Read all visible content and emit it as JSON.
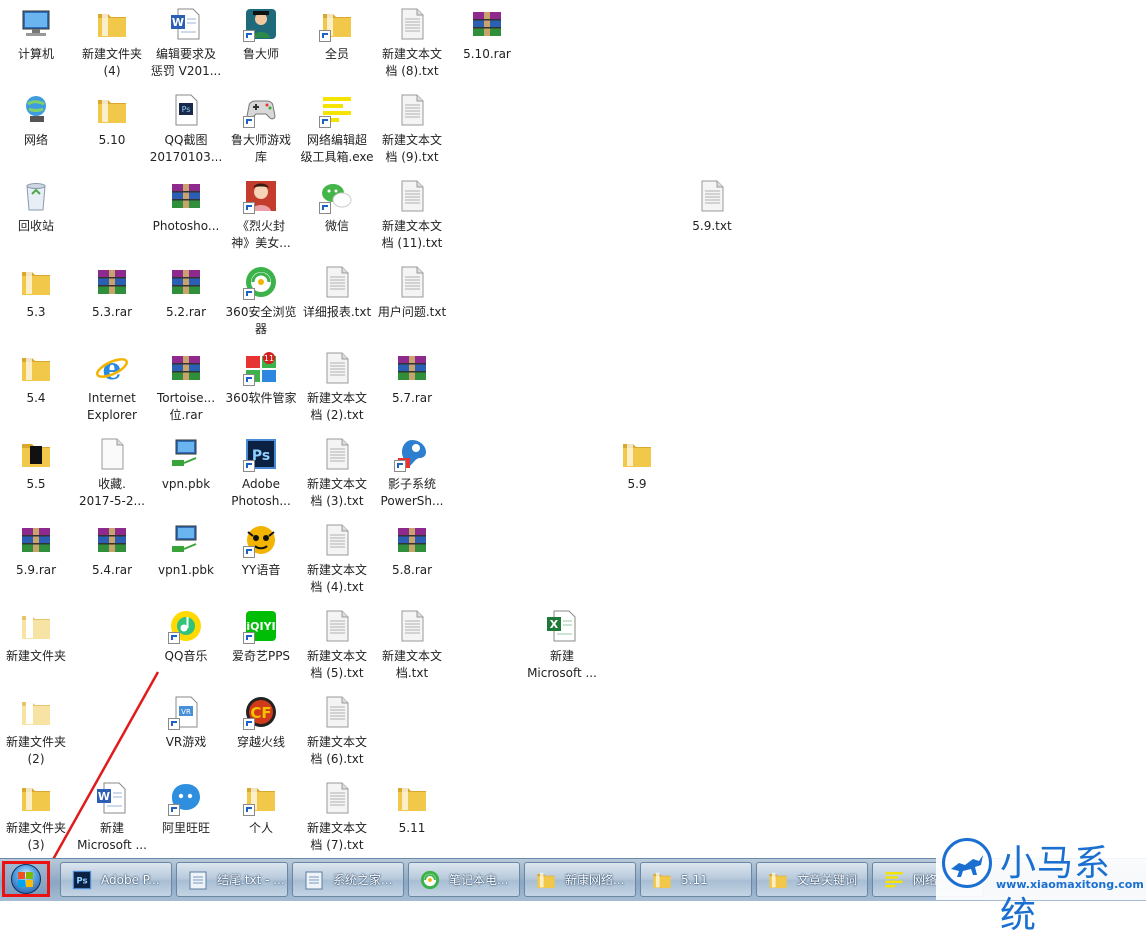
{
  "desktop_icons": [
    {
      "label": "计算机",
      "type": "computer"
    },
    {
      "label": "网络",
      "type": "network"
    },
    {
      "label": "回收站",
      "type": "recycle"
    },
    {
      "label": "5.3",
      "type": "folder"
    },
    {
      "label": "5.4",
      "type": "folder"
    },
    {
      "label": "5.5",
      "type": "folder-dark"
    },
    {
      "label": "5.9.rar",
      "type": "rar"
    },
    {
      "label": "新建文件夹",
      "type": "folder-light"
    },
    {
      "label": "新建文件夹\n(2)",
      "type": "folder-light"
    },
    {
      "label": "新建文件夹\n(3)",
      "type": "folder"
    },
    {
      "label": "新建文件夹\n(4)",
      "type": "folder"
    },
    {
      "label": "5.10",
      "type": "folder"
    },
    {
      "label": "5.3.rar",
      "type": "rar"
    },
    {
      "label": "Internet\nExplorer",
      "type": "ie"
    },
    {
      "label": "收藏.\n2017-5-2...",
      "type": "file"
    },
    {
      "label": "5.4.rar",
      "type": "rar"
    },
    {
      "label": "新建\nMicrosoft ...",
      "type": "word"
    },
    {
      "label": "编辑要求及\n惩罚 V201...",
      "type": "word"
    },
    {
      "label": "QQ截图\n20170103...",
      "type": "ps-file"
    },
    {
      "label": "Photosho...",
      "type": "rar"
    },
    {
      "label": "5.2.rar",
      "type": "rar"
    },
    {
      "label": "Tortoise...\n位.rar",
      "type": "rar"
    },
    {
      "label": "vpn.pbk",
      "type": "vpn"
    },
    {
      "label": "vpn1.pbk",
      "type": "vpn"
    },
    {
      "label": "QQ音乐",
      "type": "qqmusic"
    },
    {
      "label": "VR游戏",
      "type": "vr"
    },
    {
      "label": "阿里旺旺",
      "type": "wangwang"
    },
    {
      "label": "鲁大师",
      "type": "ludashi"
    },
    {
      "label": "鲁大师游戏\n库",
      "type": "gamepad"
    },
    {
      "label": "《烈火封\n神》美女...",
      "type": "game-girl"
    },
    {
      "label": "360安全浏览\n器",
      "type": "360browser"
    },
    {
      "label": "360软件管家",
      "type": "360mgr"
    },
    {
      "label": "Adobe\nPhotosh...",
      "type": "ps"
    },
    {
      "label": "YY语音",
      "type": "yy"
    },
    {
      "label": "爱奇艺PPS",
      "type": "iqiyi"
    },
    {
      "label": "穿越火线",
      "type": "cf"
    },
    {
      "label": "个人",
      "type": "folder"
    },
    {
      "label": "全员",
      "type": "folder"
    },
    {
      "label": "网络编辑超\n级工具箱.exe",
      "type": "toolbox"
    },
    {
      "label": "微信",
      "type": "wechat"
    },
    {
      "label": "详细报表.txt",
      "type": "txt"
    },
    {
      "label": "新建文本文\n档 (2).txt",
      "type": "txt"
    },
    {
      "label": "新建文本文\n档 (3).txt",
      "type": "txt"
    },
    {
      "label": "新建文本文\n档 (4).txt",
      "type": "txt"
    },
    {
      "label": "新建文本文\n档 (5).txt",
      "type": "txt"
    },
    {
      "label": "新建文本文\n档 (6).txt",
      "type": "txt"
    },
    {
      "label": "新建文本文\n档 (7).txt",
      "type": "txt"
    },
    {
      "label": "新建文本文\n档 (8).txt",
      "type": "txt"
    },
    {
      "label": "新建文本文\n档 (9).txt",
      "type": "txt"
    },
    {
      "label": "新建文本文\n档 (11).txt",
      "type": "txt"
    },
    {
      "label": "用户问题.txt",
      "type": "txt"
    },
    {
      "label": "5.7.rar",
      "type": "rar"
    },
    {
      "label": "影子系统\nPowerSh...",
      "type": "shadow"
    },
    {
      "label": "5.8.rar",
      "type": "rar"
    },
    {
      "label": "新建文本文\n档.txt",
      "type": "txt"
    },
    {
      "label": "5.11",
      "type": "folder"
    },
    {
      "label": "5.10.rar",
      "type": "rar"
    },
    {
      "label": "5.9.txt",
      "type": "txt"
    },
    {
      "label": "5.9",
      "type": "folder"
    },
    {
      "label": "新建\nMicrosoft ...",
      "type": "excel"
    }
  ],
  "taskbar": {
    "start_label": "开始",
    "tasks": [
      {
        "label": "Adobe P...",
        "icon": "ps"
      },
      {
        "label": "结尾.txt - ...",
        "icon": "notepad"
      },
      {
        "label": "系统之家...",
        "icon": "notepad"
      },
      {
        "label": "笔记本电...",
        "icon": "360browser"
      },
      {
        "label": "新康网络...",
        "icon": "folder"
      },
      {
        "label": "5.11",
        "icon": "folder"
      },
      {
        "label": "文章关键词",
        "icon": "folder"
      },
      {
        "label": "网络",
        "icon": "toolbox"
      }
    ]
  },
  "watermark": {
    "brand": "小马系统",
    "url": "www.xiaomaxitong.com"
  },
  "colors": {
    "folder": "#f2c84b",
    "rar": "#8e2a8e",
    "txt": "#f4f4f4",
    "accent": "#1a6fd0",
    "arrow": "#e01b1b"
  }
}
